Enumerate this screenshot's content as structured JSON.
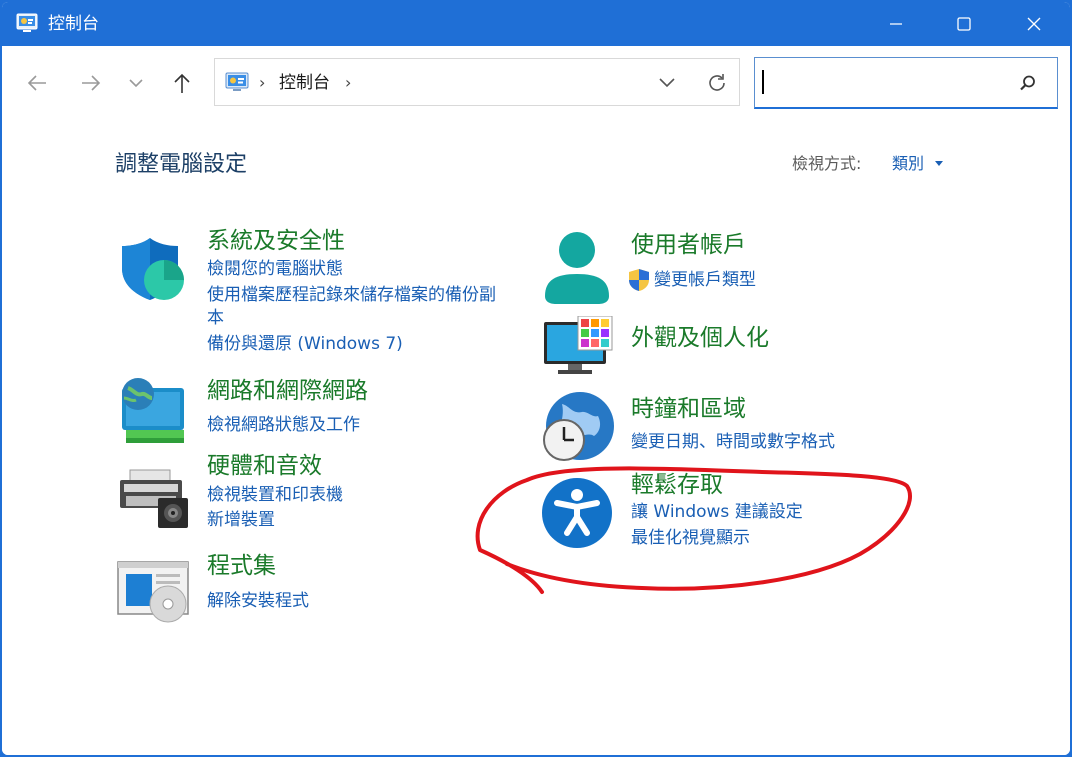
{
  "window": {
    "title": "控制台"
  },
  "nav": {
    "breadcrumb": "控制台",
    "breadcrumb_sep": "›",
    "search_value": ""
  },
  "main": {
    "heading": "調整電腦設定",
    "view_label": "檢視方式:",
    "view_value": "類別",
    "categories": [
      {
        "title": "系統及安全性",
        "icon": "shield-icon",
        "links": [
          "檢閱您的電腦狀態",
          "使用檔案歷程記錄來儲存檔案的備份副",
          "本",
          "備份與還原 (Windows 7)"
        ]
      },
      {
        "title": "網路和網際網路",
        "icon": "network-globe-icon",
        "links": [
          "檢視網路狀態及工作"
        ]
      },
      {
        "title": "硬體和音效",
        "icon": "printer-speaker-icon",
        "links": [
          "檢視裝置和印表機",
          "新增裝置"
        ]
      },
      {
        "title": "程式集",
        "icon": "programs-disc-icon",
        "links": [
          "解除安裝程式"
        ]
      },
      {
        "title": "使用者帳戶",
        "icon": "user-account-icon",
        "links": [
          "變更帳戶類型"
        ]
      },
      {
        "title": "外觀及個人化",
        "icon": "monitor-personalize-icon",
        "links": []
      },
      {
        "title": "時鐘和區域",
        "icon": "globe-clock-icon",
        "links": [
          "變更日期、時間或數字格式"
        ]
      },
      {
        "title": "輕鬆存取",
        "icon": "accessibility-icon",
        "links": [
          "讓 Windows 建議設定",
          "最佳化視覺顯示"
        ]
      }
    ]
  },
  "colors": {
    "titlebar": "#1f6fd6",
    "category_title": "#1a7a2a",
    "link": "#1a5fb4",
    "annotation": "#e0141b"
  }
}
